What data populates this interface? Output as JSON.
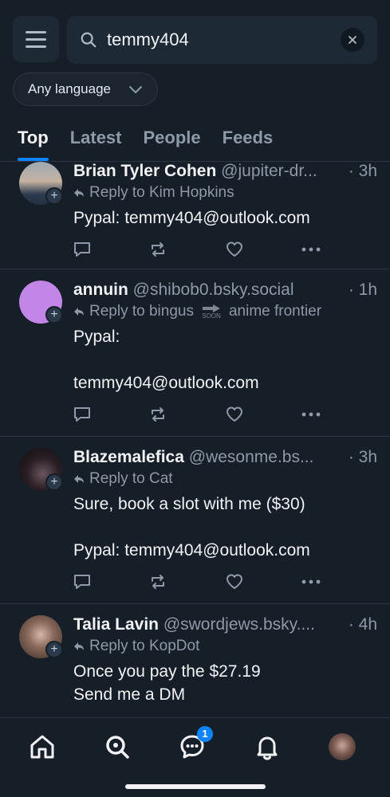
{
  "search": {
    "query": "temmy404"
  },
  "language_filter": {
    "label": "Any language"
  },
  "tabs": [
    {
      "label": "Top",
      "active": true
    },
    {
      "label": "Latest",
      "active": false
    },
    {
      "label": "People",
      "active": false
    },
    {
      "label": "Feeds",
      "active": false
    }
  ],
  "posts": [
    {
      "name": "Brian Tyler Cohen",
      "handle": "@jupiter-dr...",
      "time": "· 3h",
      "reply_to": "Reply to Kim Hopkins",
      "body": "Pypal:  temmy404@outlook.com"
    },
    {
      "name": "annuin",
      "handle": "@shibob0.bsky.social",
      "time": "· 1h",
      "reply_to": "Reply to bingus",
      "reply_to_suffix": "anime frontier",
      "soon_label": "SOON",
      "body": "Pypal:\n\ntemmy404@outlook.com"
    },
    {
      "name": "Blazemalefica",
      "handle": "@wesonme.bs...",
      "time": "· 3h",
      "reply_to": "Reply to Cat",
      "body": "Sure, book a slot with me ($30)\n\nPypal:  temmy404@outlook.com"
    },
    {
      "name": "Talia Lavin",
      "handle": "@swordjews.bsky....",
      "time": "· 4h",
      "reply_to": "Reply to KopDot",
      "body": "Once you pay the $27.19\nSend me a DM"
    }
  ],
  "nav": {
    "chat_badge": "1"
  },
  "colors": {
    "accent": "#1083fe",
    "background": "#161e27",
    "muted": "#8c9aa9"
  }
}
